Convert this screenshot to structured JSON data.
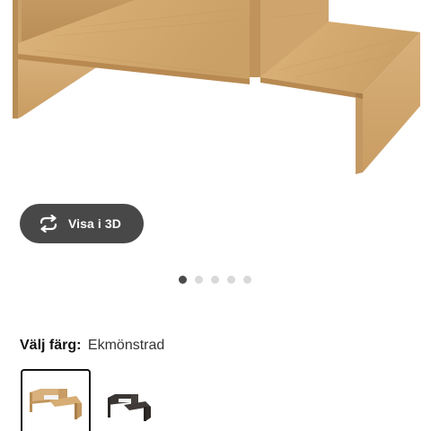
{
  "product_image": {
    "icon": "oak-coffee-table-image"
  },
  "view_3d": {
    "label": "Visa i 3D",
    "icon": "rotate-3d-icon"
  },
  "carousel": {
    "count": 5,
    "active_index": 0
  },
  "color_select": {
    "label": "Välj färg:",
    "selected_value": "Ekmönstrad",
    "options": [
      {
        "icon": "oak-table-thumbnail",
        "selected": true,
        "color": "#c89c64"
      },
      {
        "icon": "black-brown-table-thumbnail",
        "selected": false,
        "color": "#3a3634"
      }
    ]
  },
  "colors": {
    "button_bg": "#484848",
    "dot_active": "#4a4a4a",
    "dot_inactive": "#d9d9d9",
    "wood": "#d2a86f"
  }
}
